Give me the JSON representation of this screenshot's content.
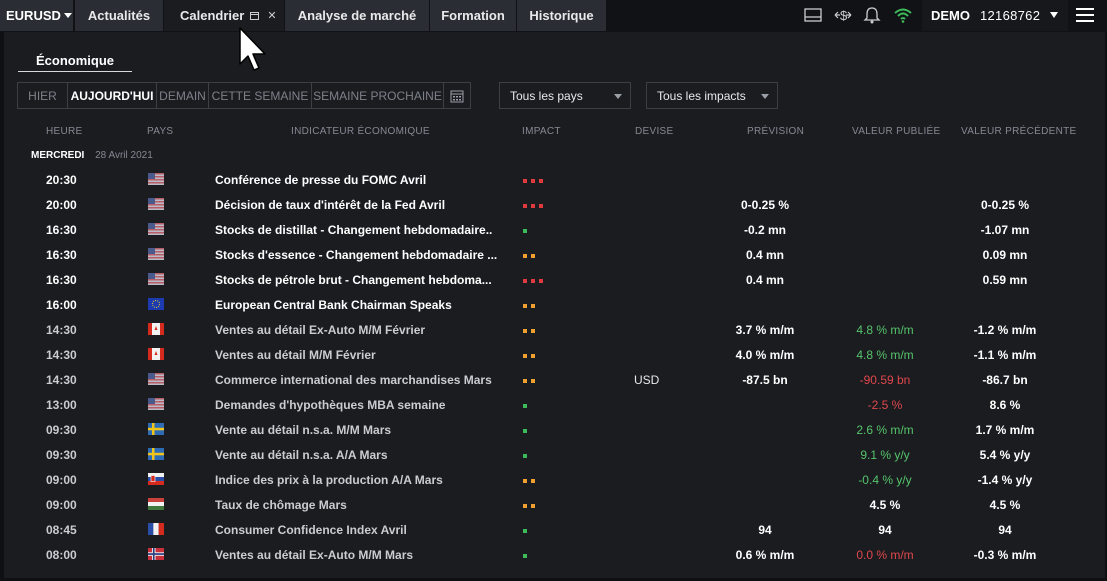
{
  "topbar": {
    "symbol": "EURUSD",
    "tabs": [
      {
        "label": "Actualités"
      },
      {
        "label": "Calendrier"
      },
      {
        "label": "Analyse de marché"
      },
      {
        "label": "Formation"
      },
      {
        "label": "Historique"
      }
    ],
    "account_mode": "DEMO",
    "account_number": "12168762"
  },
  "subtab": "Économique",
  "day_buttons": [
    "HIER",
    "AUJOURD'HUI",
    "DEMAIN",
    "CETTE SEMAINE",
    "SEMAINE PROCHAINE"
  ],
  "selected_day": "AUJOURD'HUI",
  "country_select": "Tous les pays",
  "impact_select": "Tous les impacts",
  "columns": [
    "HEURE",
    "PAYS",
    "INDICATEUR ÉCONOMIQUE",
    "IMPACT",
    "DEVISE",
    "PRÉVISION",
    "VALEUR PUBLIÉE",
    "VALEUR PRÉCÉDENTE"
  ],
  "day_label": "MERCREDI",
  "date_label": "28 Avril 2021",
  "colors": {
    "impact_high": "#e0393e",
    "impact_medium": "#f0a030",
    "impact_low": "#3dbb5a",
    "positive": "#56c46b",
    "negative": "#e0474c"
  },
  "events": [
    {
      "time": "20:30",
      "country": "us",
      "indicator": "Conférence de presse du FOMC Avril",
      "impact": 3,
      "currency": "",
      "forecast": "",
      "actual": "",
      "previous": "",
      "upcoming": true
    },
    {
      "time": "20:00",
      "country": "us",
      "indicator": "Décision de taux d'intérêt de la Fed Avril",
      "impact": 3,
      "currency": "",
      "forecast": "0-0.25 %",
      "actual": "",
      "previous": "0-0.25 %",
      "upcoming": true
    },
    {
      "time": "16:30",
      "country": "us",
      "indicator": "Stocks de distillat - Changement hebdomadaire..",
      "impact": 1,
      "currency": "",
      "forecast": "-0.2 mn",
      "actual": "",
      "previous": "-1.07 mn",
      "upcoming": true
    },
    {
      "time": "16:30",
      "country": "us",
      "indicator": "Stocks d'essence - Changement hebdomadaire ...",
      "impact": 2,
      "currency": "",
      "forecast": "0.4 mn",
      "actual": "",
      "previous": "0.09 mn",
      "upcoming": true
    },
    {
      "time": "16:30",
      "country": "us",
      "indicator": "Stocks de pétrole brut - Changement hebdoma...",
      "impact": 3,
      "currency": "",
      "forecast": "0.4 mn",
      "actual": "",
      "previous": "0.59 mn",
      "upcoming": true
    },
    {
      "time": "16:00",
      "country": "eu",
      "indicator": "European Central Bank Chairman Speaks",
      "impact": 2,
      "currency": "",
      "forecast": "",
      "actual": "",
      "previous": "",
      "upcoming": true
    },
    {
      "time": "14:30",
      "country": "ca",
      "indicator": "Ventes au détail Ex-Auto M/M Février",
      "impact": 2,
      "currency": "",
      "forecast": "3.7 % m/m",
      "actual": "4.8 % m/m",
      "actual_trend": "positive",
      "previous": "-1.2 % m/m",
      "upcoming": false
    },
    {
      "time": "14:30",
      "country": "ca",
      "indicator": "Ventes au détail M/M Février",
      "impact": 2,
      "currency": "",
      "forecast": "4.0 % m/m",
      "actual": "4.8 % m/m",
      "actual_trend": "positive",
      "previous": "-1.1 % m/m",
      "upcoming": false
    },
    {
      "time": "14:30",
      "country": "us",
      "indicator": "Commerce international des marchandises Mars",
      "impact": 2,
      "currency": "USD",
      "forecast": "-87.5 bn",
      "actual": "-90.59 bn",
      "actual_trend": "negative",
      "previous": "-86.7 bn",
      "upcoming": false
    },
    {
      "time": "13:00",
      "country": "us",
      "indicator": "Demandes d'hypothèques MBA semaine",
      "impact": 1,
      "currency": "",
      "forecast": "",
      "actual": "-2.5 %",
      "actual_trend": "negative",
      "previous": "8.6 %",
      "upcoming": false
    },
    {
      "time": "09:30",
      "country": "se",
      "indicator": "Vente au détail n.s.a. M/M Mars",
      "impact": 1,
      "currency": "",
      "forecast": "",
      "actual": "2.6 % m/m",
      "actual_trend": "positive",
      "previous": "1.7 % m/m",
      "upcoming": false
    },
    {
      "time": "09:30",
      "country": "se",
      "indicator": "Vente au détail n.s.a. A/A Mars",
      "impact": 1,
      "currency": "",
      "forecast": "",
      "actual": "9.1 % y/y",
      "actual_trend": "positive",
      "previous": "5.4 % y/y",
      "upcoming": false
    },
    {
      "time": "09:00",
      "country": "sk",
      "indicator": "Indice des prix à la production A/A Mars",
      "impact": 2,
      "currency": "",
      "forecast": "",
      "actual": "-0.4 % y/y",
      "actual_trend": "positive",
      "previous": "-1.4 % y/y",
      "upcoming": false
    },
    {
      "time": "09:00",
      "country": "hu",
      "indicator": "Taux de chômage Mars",
      "impact": 2,
      "currency": "",
      "forecast": "",
      "actual": "4.5 %",
      "actual_trend": "neutral",
      "previous": "4.5 %",
      "upcoming": false
    },
    {
      "time": "08:45",
      "country": "fr",
      "indicator": "Consumer Confidence Index Avril",
      "impact": 1,
      "currency": "",
      "forecast": "94",
      "actual": "94",
      "actual_trend": "neutral",
      "previous": "94",
      "upcoming": false
    },
    {
      "time": "08:00",
      "country": "no",
      "indicator": "Ventes au détail Ex-Auto M/M Mars",
      "impact": 1,
      "currency": "",
      "forecast": "0.6 % m/m",
      "actual": "0.0 % m/m",
      "actual_trend": "negative",
      "previous": "-0.3 % m/m",
      "upcoming": false
    }
  ]
}
